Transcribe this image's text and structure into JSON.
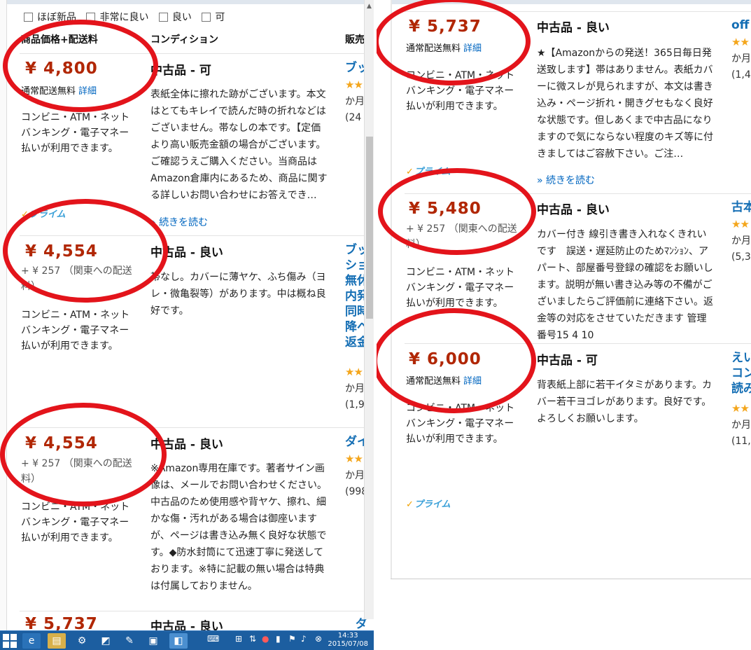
{
  "filters": [
    "ほぼ新品",
    "非常に良い",
    "良い",
    "可"
  ],
  "headers": {
    "price": "商品価格+配送料",
    "condition": "コンディション",
    "seller": "販売"
  },
  "pay_text": "コンビニ・ATM・ネットバンキング・電子マネー払いが利用できます。",
  "free_shipping": "通常配送無料",
  "details_link": "詳細",
  "read_more": "続きを読む",
  "prime_label": "プライム",
  "left_rows": [
    {
      "price": "¥ 4,800",
      "condition": "中古品 - 可",
      "desc": "表紙全体に擦れた跡がございます。本文はとてもキレイで読んだ時の折れなどはございません。帯なしの本です。【定価より高い販売金額の場合がございます。ご確認うえご購入ください。当商品はAmazon倉庫内にあるため、商品に関する詳しいお問い合わせにお答えでき…",
      "seller": "ブッ",
      "seller_meta": "か月",
      "seller_count": "(24"
    },
    {
      "price": "¥ 4,554",
      "shipfee": "+ ¥ 257 （関東への配送料）",
      "condition": "中古品 - 良い",
      "desc": "帯なし。カバーに薄ヤケ、ふち傷み（ヨレ・微亀裂等）があります。中は概ね良好です。",
      "seller_lines": [
        "ブッ",
        "ショ",
        "無休",
        "内発",
        "同時",
        "降へ",
        "返金"
      ],
      "seller_meta": "か月",
      "seller_count": "(1,9"
    },
    {
      "price": "¥ 4,554",
      "shipfee": "+ ¥ 257 （関東への配送料）",
      "condition": "中古品 - 良い",
      "desc": "※Amazon専用在庫です。著者サイン画像は、メールでお問い合わせください。中古品のため使用感や背ヤケ、擦れ、細かな傷・汚れがある場合は御座いますが、ページは書き込み無く良好な状態です。◆防水封筒にて迅速丁寧に発送しております。※特に記載の無い場合は特典は付属しておりません。",
      "seller": "ダイ",
      "seller_meta": "か月",
      "seller_count": "(998"
    }
  ],
  "left_cut": {
    "price": "¥ 5,737",
    "condition": "中古品 - 良い",
    "seller": "ダ"
  },
  "right_rows": [
    {
      "price": "¥ 5,737",
      "condition": "中古品 - 良い",
      "desc": "★【Amazonからの発送！365日毎日発送致します】帯はありません。表紙カバーに微スレが見られますが、本文は書き込み・ページ折れ・開きグセもなく良好な状態です。但しあくまで中古品になりますので気にならない程度のキズ等に付きましてはご容赦下さい。ご注…",
      "seller": "off",
      "seller_meta": "か月",
      "seller_count": "(1,4"
    },
    {
      "price": "¥ 5,480",
      "shipfee": "+ ¥ 257 （関東への配送料）",
      "condition": "中古品 - 良い",
      "desc": "カバー付き 線引き書き入れなくきれいです　誤送・遅延防止のためﾏﾝｼｮﾝ、アパート、部屋番号登録の確認をお願いします。説明が無い書き込み等の不備がございましたらご評価前に連絡下さい。返金等の対応をさせていただきます 管理番号15 4 10",
      "seller": "古本",
      "seller_meta": "か月",
      "seller_count": "(5,3"
    },
    {
      "price": "¥ 6,000",
      "condition": "中古品 - 可",
      "desc": "背表紙上部に若干イタミがあります。カバー若干ヨゴレがあります。良好です。よろしくお願いします。",
      "seller_lines": [
        "えい",
        "コン",
        "読み"
      ],
      "seller_meta": "か月",
      "seller_count": "(11,"
    }
  ],
  "stars": "★★",
  "clock": {
    "time": "14:33",
    "date": "2015/07/08"
  },
  "colors": {
    "price": "#b12704",
    "link": "#0066c0",
    "highlight_circle": "#e3141b",
    "taskbar": "#1c5ea0"
  }
}
